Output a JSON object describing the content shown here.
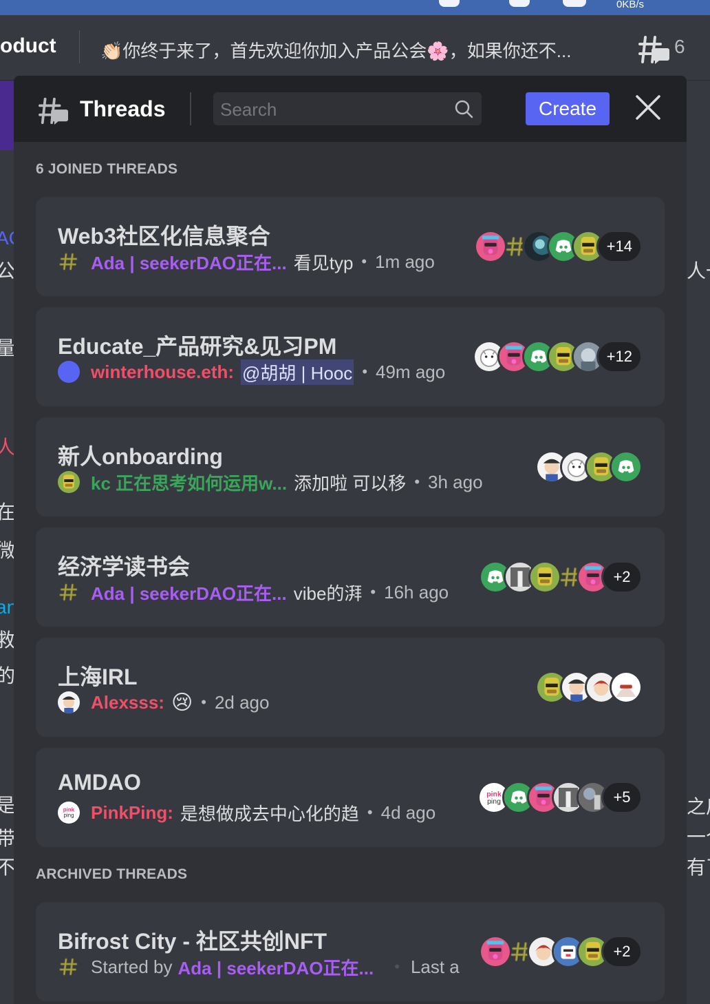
{
  "system": {
    "netspeed": "0KB/s"
  },
  "channel": {
    "name": "oduct",
    "topic": "👏🏻你终于来了，首先欢迎你加入产品公会🌸，如果你还不...",
    "thread_count": "6"
  },
  "popout": {
    "title": "Threads",
    "search_placeholder": "Search",
    "create_label": "Create",
    "joined_label": "6 JOINED THREADS",
    "archived_label": "ARCHIVED THREADS",
    "joined_threads": [
      {
        "title": "Web3社区化信息聚合",
        "author_icon": "hash-icon",
        "author": "Ada | seekerDAO正在...",
        "author_color": "#a95ef3",
        "message": "看见typ",
        "time": "1m ago",
        "avatars": [
          "pink-dog-avatar",
          "hash-avatar",
          "dark-avatar",
          "discord-avatar",
          "ape-avatar"
        ],
        "more": "+14"
      },
      {
        "title": "Educate_产品研究&见习PM",
        "author_icon": "user-avatar-icon",
        "author": "winterhouse.eth:",
        "author_color": "#f04f6a",
        "message": "@胡胡 | Hooc",
        "time": "49m ago",
        "avatars": [
          "white-cat-avatar",
          "pink-dog-avatar",
          "discord-avatar",
          "ape-avatar",
          "gray-avatar"
        ],
        "more": "+12"
      },
      {
        "title": "新人onboarding",
        "author_icon": "ape-avatar-icon",
        "author": "kc 正在思考如何运用w...",
        "author_color": "#3ba55c",
        "message": "添加啦 可以移",
        "time": "3h ago",
        "avatars": [
          "cartoon-avatar",
          "white-cat-avatar",
          "ape-avatar",
          "discord-avatar"
        ],
        "more": ""
      },
      {
        "title": "经济学读书会",
        "author_icon": "hash-icon",
        "author": "Ada | seekerDAO正在...",
        "author_color": "#a95ef3",
        "message": "vibe的湃",
        "time": "16h ago",
        "avatars": [
          "discord-avatar",
          "photo-avatar",
          "ape-avatar",
          "hash-avatar",
          "pink-dog-avatar"
        ],
        "more": "+2"
      },
      {
        "title": "上海IRL",
        "author_icon": "cartoon-avatar-icon",
        "author": "Alexsss:",
        "author_color": "#f04f6a",
        "message": "😢",
        "time": "2d ago",
        "avatars": [
          "ape-avatar",
          "cartoon-avatar",
          "red-hair-avatar",
          "anime-avatar"
        ],
        "more": ""
      },
      {
        "title": "AMDAO",
        "author_icon": "pinkping-avatar-icon",
        "author": "PinkPing:",
        "author_color": "#f04f6a",
        "message": "是想做成去中心化的趋",
        "time": "4d ago",
        "avatars": [
          "pinkping-avatar",
          "discord-avatar",
          "pink-dog-avatar",
          "photo-avatar",
          "tree-avatar"
        ],
        "more": "+5"
      }
    ],
    "archived_threads": [
      {
        "title": "Bifrost City - 社区共创NFT",
        "author_icon": "hash-icon",
        "started_label": "Started by",
        "author": "Ada | seekerDAO正在...",
        "author_color": "#a95ef3",
        "time": "Last a",
        "avatars": [
          "pink-dog-avatar",
          "hash-avatar",
          "red-hair-avatar",
          "robot-avatar",
          "ape-avatar"
        ],
        "more": "+2"
      }
    ]
  },
  "background": {
    "chars": [
      "AC",
      "公",
      "量",
      "人",
      "在",
      "微",
      "an",
      "救",
      "的",
      "是",
      "带",
      "不"
    ],
    "right_chars": [
      "人一",
      "之后",
      "一个",
      "有了"
    ]
  }
}
